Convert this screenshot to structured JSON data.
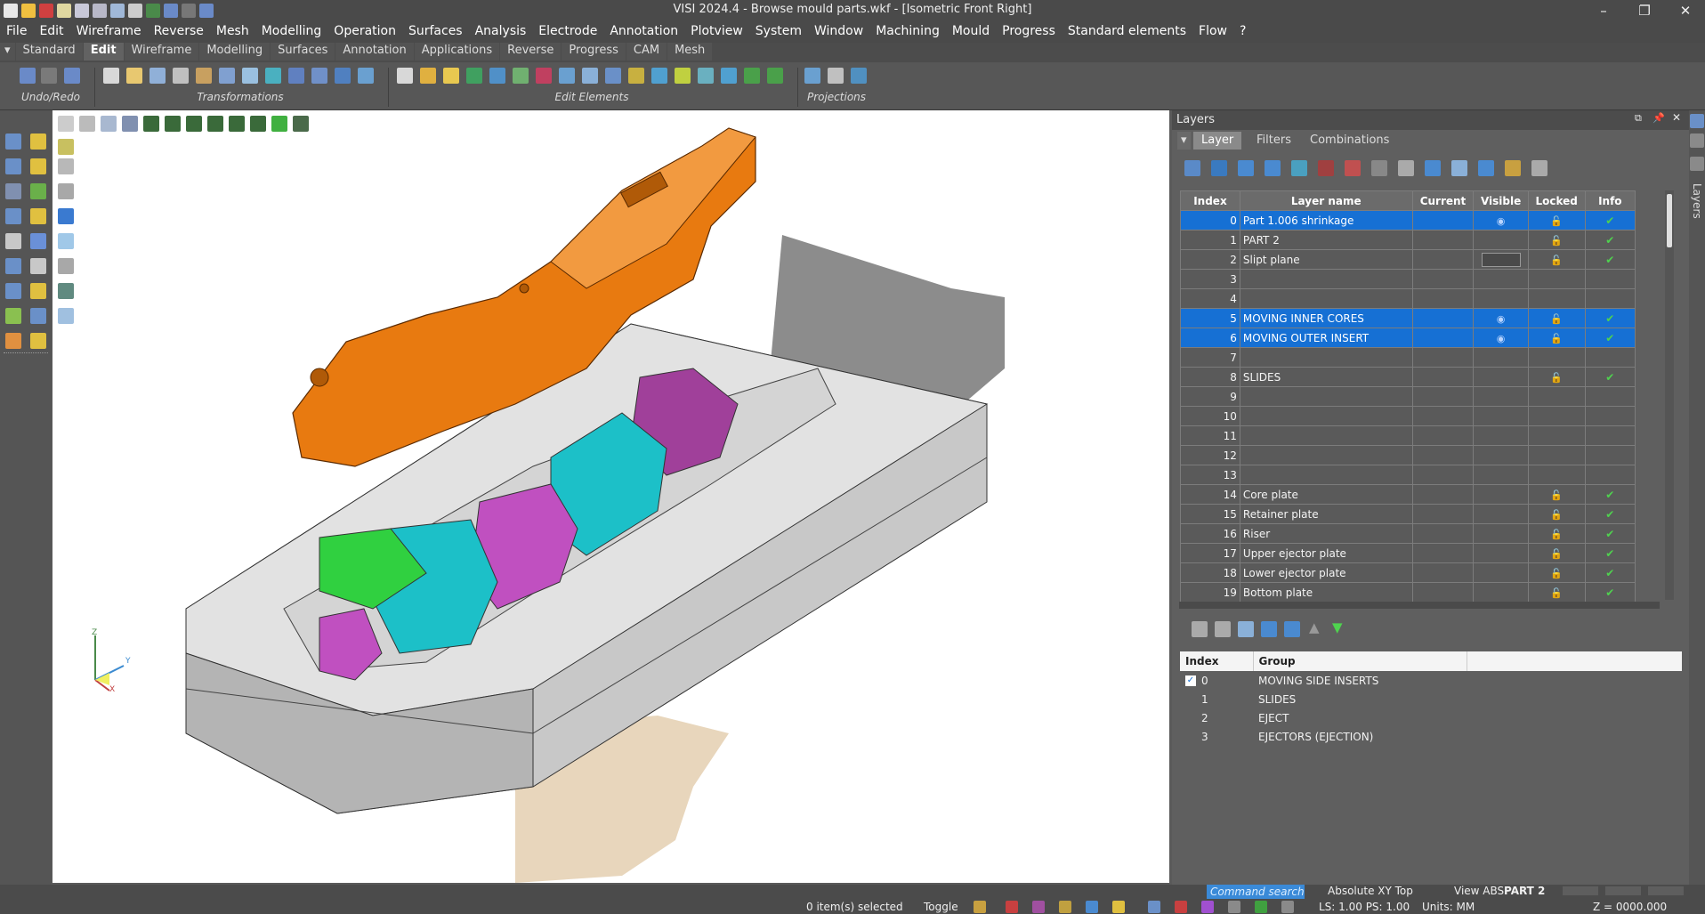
{
  "app": {
    "title": "VISI 2024.4 - Browse mould parts.wkf - [Isometric Front Right]"
  },
  "menu": [
    "File",
    "Edit",
    "Wireframe",
    "Reverse",
    "Mesh",
    "Modelling",
    "Operation",
    "Surfaces",
    "Analysis",
    "Electrode",
    "Annotation",
    "Plotview",
    "System",
    "Window",
    "Machining",
    "Mould",
    "Progress",
    "Standard elements",
    "Flow",
    "?"
  ],
  "tabs": [
    {
      "label": "Standard",
      "active": false
    },
    {
      "label": "Edit",
      "active": true
    },
    {
      "label": "Wireframe",
      "active": false
    },
    {
      "label": "Modelling",
      "active": false
    },
    {
      "label": "Surfaces",
      "active": false
    },
    {
      "label": "Annotation",
      "active": false
    },
    {
      "label": "Applications",
      "active": false
    },
    {
      "label": "Reverse",
      "active": false
    },
    {
      "label": "Progress",
      "active": false
    },
    {
      "label": "CAM",
      "active": false
    },
    {
      "label": "Mesh",
      "active": false
    }
  ],
  "ribbon_groups": {
    "undo_redo": "Undo/Redo",
    "transformations": "Transformations",
    "edit_elements": "Edit Elements",
    "projections": "Projections"
  },
  "layers_panel": {
    "title": "Layers",
    "tabs": [
      {
        "label": "Layer",
        "active": true
      },
      {
        "label": "Filters",
        "active": false
      },
      {
        "label": "Combinations",
        "active": false
      }
    ],
    "side_tab": "Layers",
    "columns": [
      "Index",
      "Layer name",
      "Current",
      "Visible",
      "Locked",
      "Info"
    ],
    "rows": [
      {
        "index": "0",
        "name": "Part 1.006 shrinkage",
        "visible": true,
        "locked": true,
        "info": true,
        "selected": true
      },
      {
        "index": "1",
        "name": "PART 2",
        "visible": false,
        "locked": true,
        "info": true,
        "selected": false
      },
      {
        "index": "2",
        "name": "Slipt plane",
        "visible": false,
        "visbox": true,
        "locked": true,
        "info": true,
        "selected": false
      },
      {
        "index": "3",
        "name": "",
        "visible": false,
        "locked": false,
        "info": false,
        "selected": false
      },
      {
        "index": "4",
        "name": "",
        "visible": false,
        "locked": false,
        "info": false,
        "selected": false
      },
      {
        "index": "5",
        "name": "MOVING INNER CORES",
        "visible": true,
        "locked": true,
        "info": true,
        "selected": true
      },
      {
        "index": "6",
        "name": "MOVING OUTER INSERT",
        "visible": true,
        "locked": true,
        "info": true,
        "selected": true
      },
      {
        "index": "7",
        "name": "",
        "visible": false,
        "locked": false,
        "info": false,
        "selected": false
      },
      {
        "index": "8",
        "name": "SLIDES",
        "visible": false,
        "locked": true,
        "info": true,
        "selected": false
      },
      {
        "index": "9",
        "name": "",
        "visible": false,
        "locked": false,
        "info": false,
        "selected": false
      },
      {
        "index": "10",
        "name": "",
        "visible": false,
        "locked": false,
        "info": false,
        "selected": false
      },
      {
        "index": "11",
        "name": "",
        "visible": false,
        "locked": false,
        "info": false,
        "selected": false
      },
      {
        "index": "12",
        "name": "",
        "visible": false,
        "locked": false,
        "info": false,
        "selected": false
      },
      {
        "index": "13",
        "name": "",
        "visible": false,
        "locked": false,
        "info": false,
        "selected": false
      },
      {
        "index": "14",
        "name": "Core plate",
        "visible": false,
        "locked": true,
        "info": true,
        "selected": false
      },
      {
        "index": "15",
        "name": "Retainer plate",
        "visible": false,
        "locked": true,
        "info": true,
        "selected": false
      },
      {
        "index": "16",
        "name": "Riser",
        "visible": false,
        "locked": true,
        "info": true,
        "selected": false
      },
      {
        "index": "17",
        "name": "Upper ejector plate",
        "visible": false,
        "locked": true,
        "info": true,
        "selected": false
      },
      {
        "index": "18",
        "name": "Lower ejector plate",
        "visible": false,
        "locked": true,
        "info": true,
        "selected": false
      },
      {
        "index": "19",
        "name": "Bottom plate",
        "visible": false,
        "locked": true,
        "info": true,
        "selected": false
      }
    ],
    "group_columns": [
      "Index",
      "Group"
    ],
    "groups": [
      {
        "index": "0",
        "name": "MOVING SIDE INSERTS",
        "checked": true
      },
      {
        "index": "1",
        "name": "SLIDES",
        "checked": false
      },
      {
        "index": "2",
        "name": "EJECT",
        "checked": false
      },
      {
        "index": "3",
        "name": "EJECTORS (EJECTION)",
        "checked": false
      }
    ]
  },
  "axis_labels": {
    "z": "Z",
    "y": "Y",
    "x": "X"
  },
  "bottom_bar": {
    "command_search_placeholder": "Command search",
    "plane": "Absolute XY Top",
    "view": "View ABS",
    "current_layer": "PART 2"
  },
  "status": {
    "selected": "0 item(s) selected",
    "toggle": "Toggle",
    "ls_ps": "LS: 1.00 PS: 1.00",
    "units": "Units: MM",
    "coords_z": "Z = 0000.000"
  },
  "colors": {
    "selection": "#1670d4",
    "part_orange": "#e87a10",
    "insert_cyan": "#1cc0c8",
    "insert_magenta": "#a0409a",
    "insert_green": "#30d040",
    "info_check": "#4fd24f"
  }
}
